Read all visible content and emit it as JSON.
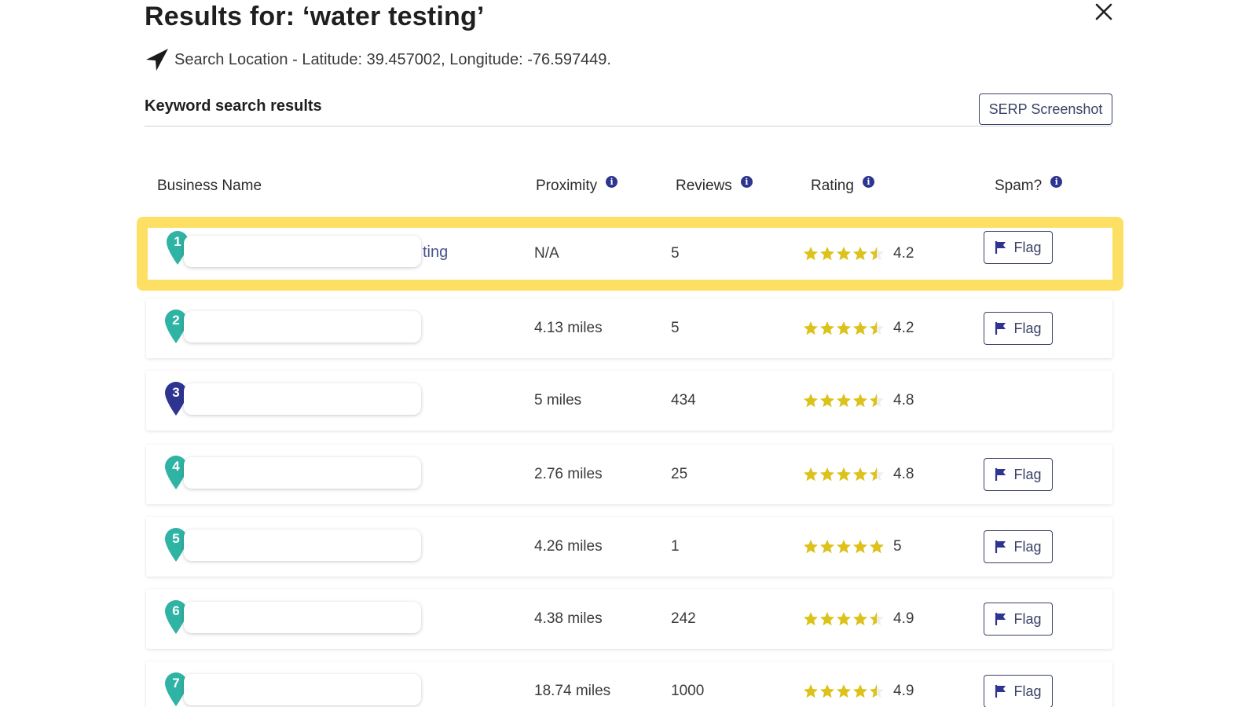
{
  "header": {
    "title": "Results for: ‘water testing’",
    "location_text": "Search Location - Latitude: 39.457002, Longitude: -76.597449."
  },
  "section": {
    "title": "Keyword search results",
    "serp_button": "SERP Screenshot"
  },
  "columns": {
    "business_name": "Business Name",
    "proximity": "Proximity",
    "reviews": "Reviews",
    "rating": "Rating",
    "spam": "Spam?"
  },
  "colors": {
    "pin_teal": "#2fb3a4",
    "pin_navy": "#2d3590",
    "star_yellow": "#dcc21a",
    "highlight": "#fde063",
    "button_border": "#3a4266"
  },
  "rows": [
    {
      "rank": "1",
      "name_tail": "ting",
      "proximity": "N/A",
      "reviews": "5",
      "rating": "4.2",
      "stars": 4.5,
      "flag": "Flag",
      "pin_color": "teal",
      "highlight": true
    },
    {
      "rank": "2",
      "name_tail": "",
      "proximity": "4.13 miles",
      "reviews": "5",
      "rating": "4.2",
      "stars": 4.5,
      "flag": "Flag",
      "pin_color": "teal",
      "highlight": false
    },
    {
      "rank": "3",
      "name_tail": "",
      "proximity": "5 miles",
      "reviews": "434",
      "rating": "4.8",
      "stars": 4.5,
      "flag": "",
      "pin_color": "navy",
      "highlight": false
    },
    {
      "rank": "4",
      "name_tail": "",
      "proximity": "2.76 miles",
      "reviews": "25",
      "rating": "4.8",
      "stars": 4.5,
      "flag": "Flag",
      "pin_color": "teal",
      "highlight": false
    },
    {
      "rank": "5",
      "name_tail": "",
      "proximity": "4.26 miles",
      "reviews": "1",
      "rating": "5",
      "stars": 5,
      "flag": "Flag",
      "pin_color": "teal",
      "highlight": false
    },
    {
      "rank": "6",
      "name_tail": "",
      "proximity": "4.38 miles",
      "reviews": "242",
      "rating": "4.9",
      "stars": 4.5,
      "flag": "Flag",
      "pin_color": "teal",
      "highlight": false
    },
    {
      "rank": "7",
      "name_tail": "",
      "proximity": "18.74 miles",
      "reviews": "1000",
      "rating": "4.9",
      "stars": 4.5,
      "flag": "Flag",
      "pin_color": "teal",
      "highlight": false
    }
  ]
}
